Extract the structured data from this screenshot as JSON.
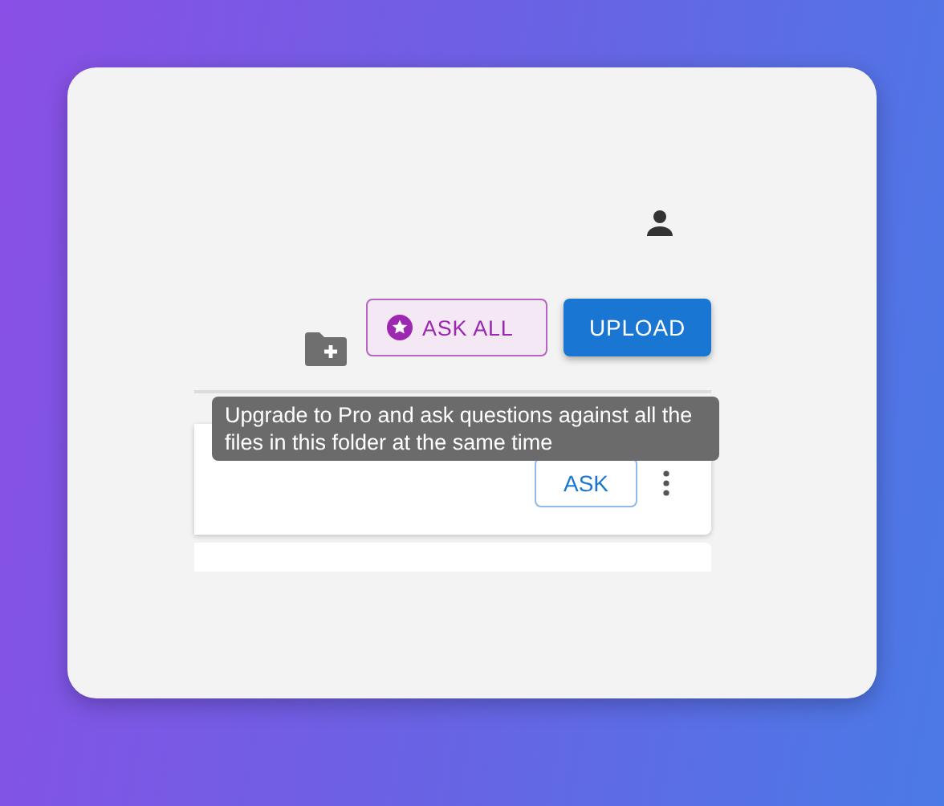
{
  "buttons": [
    {
      "label": "ASK ALL",
      "kind": "pro"
    },
    {
      "label": "UPLOAD",
      "kind": "primary"
    }
  ],
  "tooltip": "Upgrade to Pro and ask questions against all the files in this folder at the same time",
  "files": [
    {
      "ask_label": "ASK"
    }
  ]
}
